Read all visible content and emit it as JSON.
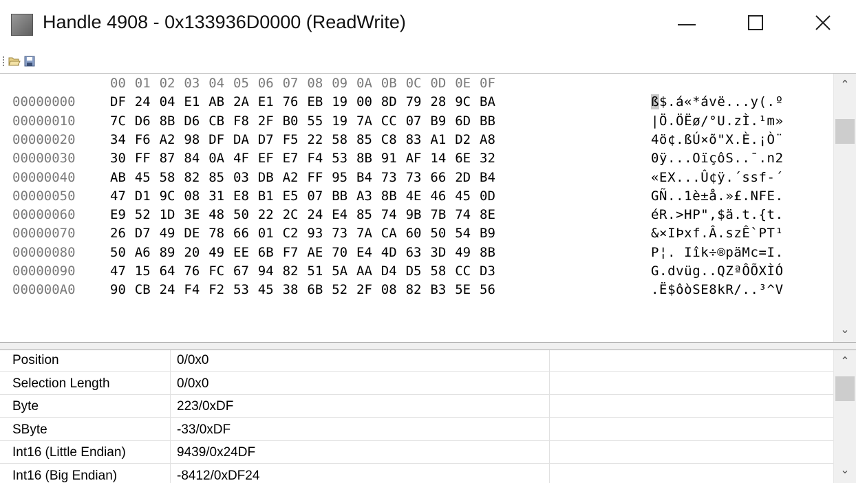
{
  "window": {
    "title": "Handle 4908 - 0x133936D0000 (ReadWrite)",
    "minimize_glyph": "—",
    "close_glyph": "✕"
  },
  "toolbar": {
    "open_icon": "folder-open-icon",
    "save_icon": "save-icon"
  },
  "hexview": {
    "column_headers": [
      "00",
      "01",
      "02",
      "03",
      "04",
      "05",
      "06",
      "07",
      "08",
      "09",
      "0A",
      "0B",
      "0C",
      "0D",
      "0E",
      "0F"
    ],
    "rows": [
      {
        "offset": "00000000",
        "bytes": [
          "DF",
          "24",
          "04",
          "E1",
          "AB",
          "2A",
          "E1",
          "76",
          "EB",
          "19",
          "00",
          "8D",
          "79",
          "28",
          "9C",
          "BA"
        ],
        "ascii_first": "ß",
        "ascii": "$.á«*ávë...y(.º"
      },
      {
        "offset": "00000010",
        "bytes": [
          "7C",
          "D6",
          "8B",
          "D6",
          "CB",
          "F8",
          "2F",
          "B0",
          "55",
          "19",
          "7A",
          "CC",
          "07",
          "B9",
          "6D",
          "BB"
        ],
        "ascii_first": "",
        "ascii": "|Ö.ÖËø/°U.zÌ.¹m»"
      },
      {
        "offset": "00000020",
        "bytes": [
          "34",
          "F6",
          "A2",
          "98",
          "DF",
          "DA",
          "D7",
          "F5",
          "22",
          "58",
          "85",
          "C8",
          "83",
          "A1",
          "D2",
          "A8"
        ],
        "ascii_first": "",
        "ascii": "4ö¢.ßÚ×õ\"X.È.¡Ò¨"
      },
      {
        "offset": "00000030",
        "bytes": [
          "30",
          "FF",
          "87",
          "84",
          "0A",
          "4F",
          "EF",
          "E7",
          "F4",
          "53",
          "8B",
          "91",
          "AF",
          "14",
          "6E",
          "32"
        ],
        "ascii_first": "",
        "ascii": "0ÿ...OïçôS..¯.n2"
      },
      {
        "offset": "00000040",
        "bytes": [
          "AB",
          "45",
          "58",
          "82",
          "85",
          "03",
          "DB",
          "A2",
          "FF",
          "95",
          "B4",
          "73",
          "73",
          "66",
          "2D",
          "B4"
        ],
        "ascii_first": "",
        "ascii": "«EX...Û¢ÿ.´ssf-´"
      },
      {
        "offset": "00000050",
        "bytes": [
          "47",
          "D1",
          "9C",
          "08",
          "31",
          "E8",
          "B1",
          "E5",
          "07",
          "BB",
          "A3",
          "8B",
          "4E",
          "46",
          "45",
          "0D"
        ],
        "ascii_first": "",
        "ascii": "GÑ..1è±å.»£.NFE."
      },
      {
        "offset": "00000060",
        "bytes": [
          "E9",
          "52",
          "1D",
          "3E",
          "48",
          "50",
          "22",
          "2C",
          "24",
          "E4",
          "85",
          "74",
          "9B",
          "7B",
          "74",
          "8E"
        ],
        "ascii_first": "",
        "ascii": "éR.>HP\",$ä.t.{t."
      },
      {
        "offset": "00000070",
        "bytes": [
          "26",
          "D7",
          "49",
          "DE",
          "78",
          "66",
          "01",
          "C2",
          "93",
          "73",
          "7A",
          "CA",
          "60",
          "50",
          "54",
          "B9"
        ],
        "ascii_first": "",
        "ascii": "&×IÞxf.Â.szÊ`PT¹"
      },
      {
        "offset": "00000080",
        "bytes": [
          "50",
          "A6",
          "89",
          "20",
          "49",
          "EE",
          "6B",
          "F7",
          "AE",
          "70",
          "E4",
          "4D",
          "63",
          "3D",
          "49",
          "8B"
        ],
        "ascii_first": "",
        "ascii": "P¦. Iîk÷®päMc=I."
      },
      {
        "offset": "00000090",
        "bytes": [
          "47",
          "15",
          "64",
          "76",
          "FC",
          "67",
          "94",
          "82",
          "51",
          "5A",
          "AA",
          "D4",
          "D5",
          "58",
          "CC",
          "D3"
        ],
        "ascii_first": "",
        "ascii": "G.dvüg..QZªÔÕXÌÓ"
      },
      {
        "offset": "000000A0",
        "bytes": [
          "90",
          "CB",
          "24",
          "F4",
          "F2",
          "53",
          "45",
          "38",
          "6B",
          "52",
          "2F",
          "08",
          "82",
          "B3",
          "5E",
          "56"
        ],
        "ascii_first": "",
        "ascii": ".Ë$ôòSE8kR/..³^V"
      }
    ]
  },
  "properties": [
    {
      "name": "Position",
      "value": "0/0x0"
    },
    {
      "name": "Selection Length",
      "value": "0/0x0"
    },
    {
      "name": "Byte",
      "value": "223/0xDF"
    },
    {
      "name": "SByte",
      "value": "-33/0xDF"
    },
    {
      "name": "Int16 (Little Endian)",
      "value": "9439/0x24DF"
    },
    {
      "name": "Int16 (Big Endian)",
      "value": "-8412/0xDF24"
    }
  ],
  "scrollbar": {
    "up_glyph": "⌃",
    "down_glyph": "⌄"
  }
}
